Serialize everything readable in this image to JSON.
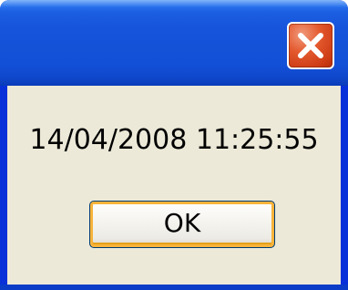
{
  "dialog": {
    "title": "",
    "message": "14/04/2008 11:25:55",
    "ok_label": "OK",
    "close_icon": "close-icon",
    "colors": {
      "titlebar": "#1655dc",
      "client": "#ece9d8",
      "close_button": "#e4592e",
      "ok_focus_ring": "#f8b33a"
    }
  }
}
